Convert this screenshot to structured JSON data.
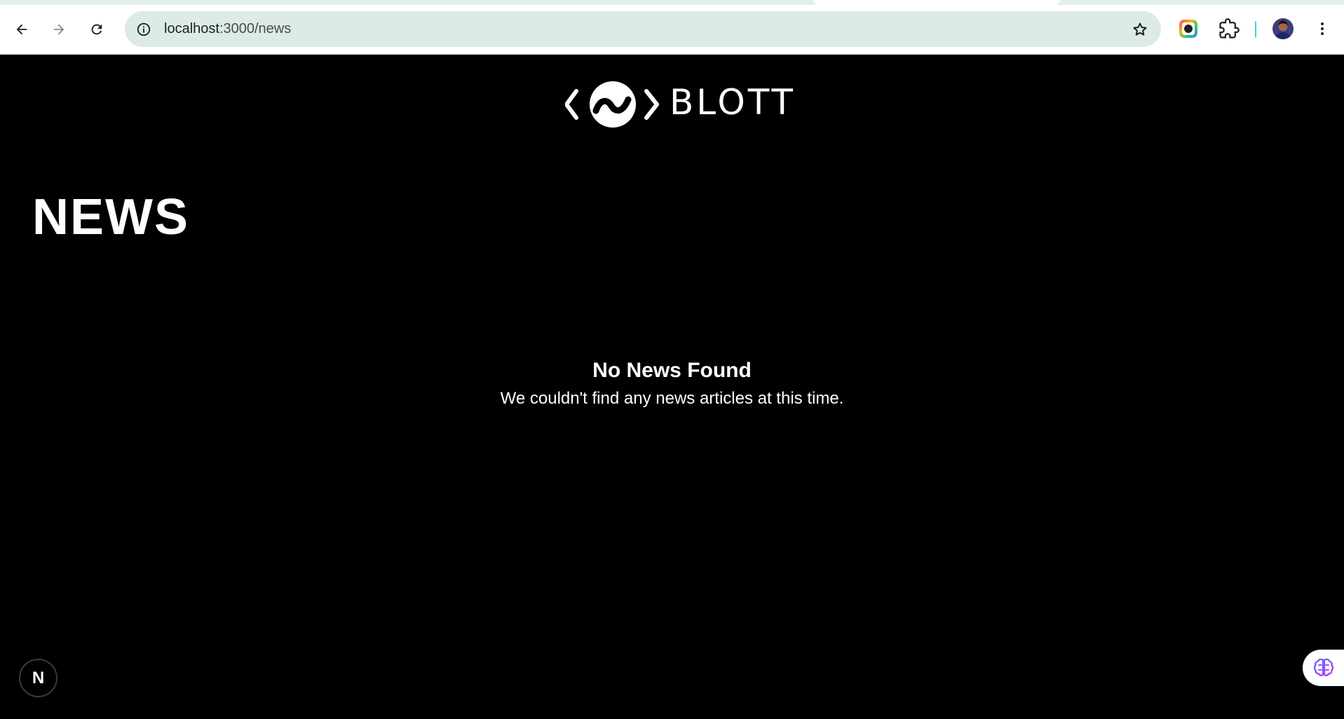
{
  "browser": {
    "url_host": "localhost",
    "url_path": ":3000/news",
    "back_label": "Back",
    "forward_label": "Forward",
    "reload_label": "Reload",
    "colors": {
      "omnibox_bg": "#dcebe7",
      "tabstrip": "#e4efec",
      "divider_accent": "#4cc9d8"
    }
  },
  "page": {
    "logo_text": "BLOTT",
    "title": "NEWS",
    "empty_state": {
      "title": "No News Found",
      "description": "We couldn't find any news articles at this time."
    },
    "dev_badge_letter": "N",
    "colors": {
      "background": "#000000",
      "text": "#ffffff"
    }
  },
  "icons": {
    "back": "arrow-left-icon",
    "forward": "arrow-right-icon",
    "reload": "reload-icon",
    "site_info": "info-icon",
    "bookmark": "star-icon",
    "color_extension": "color-picker-icon",
    "extensions": "puzzle-icon",
    "menu": "kebab-menu-icon",
    "ai_widget": "brain-icon"
  }
}
